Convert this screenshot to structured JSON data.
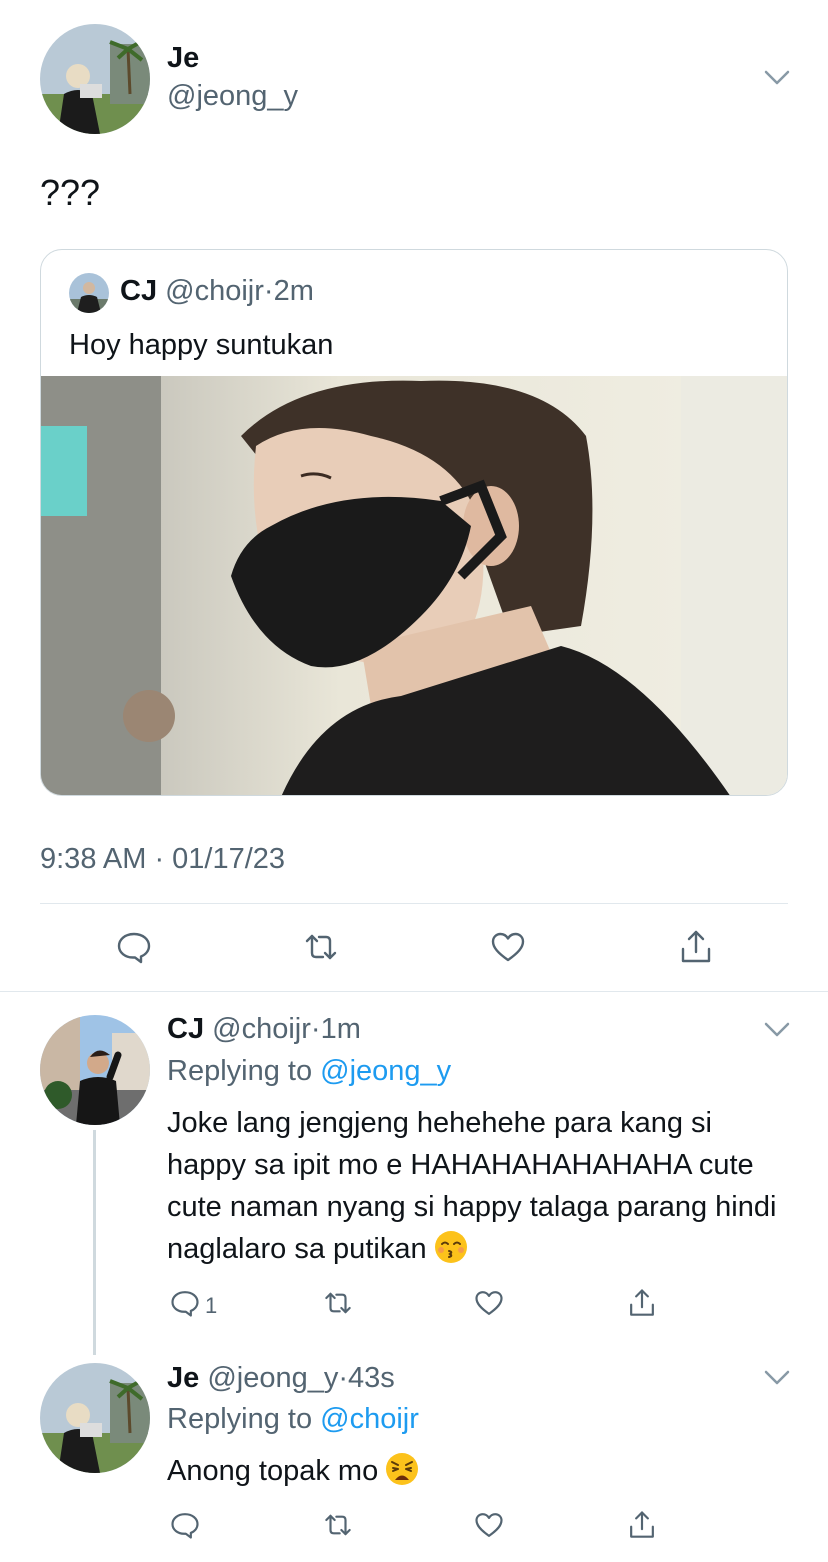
{
  "main_tweet": {
    "author_name": "Je",
    "author_handle": "@jeong_y",
    "text": "???",
    "quoted": {
      "author_name": "CJ",
      "author_handle": "@choijr",
      "separator": "·",
      "time": "2m",
      "text": "Hoy happy suntukan"
    },
    "timestamp": "9:38 AM · 01/17/23"
  },
  "replies": [
    {
      "author_name": "CJ",
      "author_handle": "@choijr",
      "separator": "·",
      "time": "1m",
      "replying_label": "Replying to",
      "replying_to": "@jeong_y",
      "text": "Joke lang jengjeng hehehehe para kang si happy sa ipit mo e HAHAHAHAHAHAHA cute cute naman nyang si happy talaga parang hindi naglalaro sa putikan",
      "emoji": "kissing-face-with-closed-eyes",
      "reply_count": "1"
    },
    {
      "author_name": "Je",
      "author_handle": "@jeong_y",
      "separator": "·",
      "time": "43s",
      "replying_label": "Replying to",
      "replying_to": "@choijr",
      "text": "Anong topak mo",
      "emoji": "weary-face",
      "reply_count": ""
    }
  ],
  "colors": {
    "accent": "#1d9bf0",
    "secondary_text": "#536471",
    "primary_text": "#0f1419",
    "border": "#cfd9de"
  },
  "icons": [
    "chevron-down-icon",
    "reply-icon",
    "retweet-icon",
    "like-icon",
    "share-icon"
  ]
}
